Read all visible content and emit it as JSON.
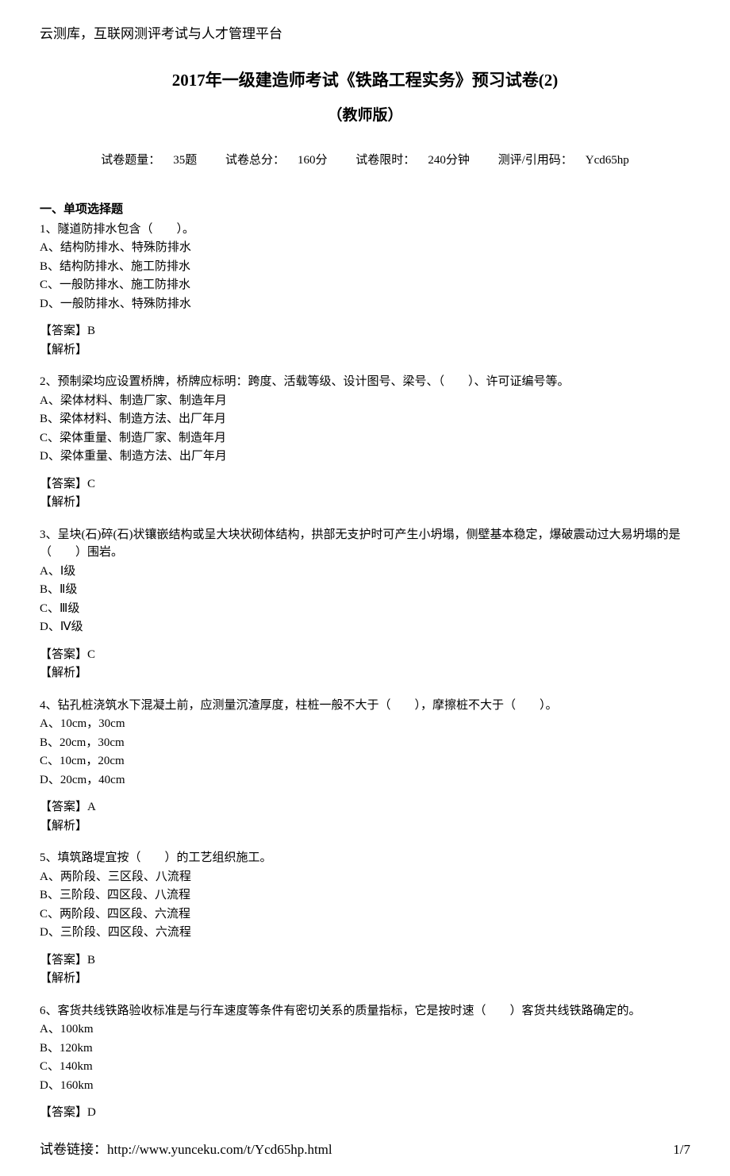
{
  "header": "云测库，互联网测评考试与人才管理平台",
  "title": "2017年一级建造师考试《铁路工程实务》预习试卷(2)",
  "subtitle": "（教师版）",
  "meta": {
    "count_label": "试卷题量：",
    "count_value": "35题",
    "score_label": "试卷总分：",
    "score_value": "160分",
    "time_label": "试卷限时：",
    "time_value": "240分钟",
    "code_label": "测评/引用码：",
    "code_value": "Ycd65hp"
  },
  "section_header": "一、单项选择题",
  "questions": [
    {
      "text": "1、隧道防排水包含（　　）。",
      "options": [
        "A、结构防排水、特殊防排水",
        "B、结构防排水、施工防排水",
        "C、一般防排水、施工防排水",
        "D、一般防排水、特殊防排水"
      ],
      "answer": "【答案】B",
      "analysis": "【解析】"
    },
    {
      "text": "2、预制梁均应设置桥牌，桥牌应标明：跨度、活载等级、设计图号、梁号、（　　）、许可证编号等。",
      "options": [
        "A、梁体材料、制造厂家、制造年月",
        "B、梁体材料、制造方法、出厂年月",
        "C、梁体重量、制造厂家、制造年月",
        "D、梁体重量、制造方法、出厂年月"
      ],
      "answer": "【答案】C",
      "analysis": "【解析】"
    },
    {
      "text": "3、呈块(石)碎(石)状镶嵌结构或呈大块状砌体结构，拱部无支护时可产生小坍塌，侧壁基本稳定，爆破震动过大易坍塌的是（　　）围岩。",
      "options": [
        "A、Ⅰ级",
        "B、Ⅱ级",
        "C、Ⅲ级",
        "D、Ⅳ级"
      ],
      "answer": "【答案】C",
      "analysis": "【解析】"
    },
    {
      "text": "4、钻孔桩浇筑水下混凝土前，应测量沉渣厚度，柱桩一般不大于（　　），摩擦桩不大于（　　）。",
      "options": [
        "A、10cm，30cm",
        "B、20cm，30cm",
        "C、10cm，20cm",
        "D、20cm，40cm"
      ],
      "answer": "【答案】A",
      "analysis": "【解析】"
    },
    {
      "text": "5、填筑路堤宜按（　　）的工艺组织施工。",
      "options": [
        "A、两阶段、三区段、八流程",
        "B、三阶段、四区段、八流程",
        "C、两阶段、四区段、六流程",
        "D、三阶段、四区段、六流程"
      ],
      "answer": "【答案】B",
      "analysis": "【解析】"
    },
    {
      "text": "6、客货共线铁路验收标准是与行车速度等条件有密切关系的质量指标，它是按时速（　　）客货共线铁路确定的。",
      "options": [
        "A、100km",
        "B、120km",
        "C、140km",
        "D、160km"
      ],
      "answer": "【答案】D",
      "analysis": ""
    }
  ],
  "footer": {
    "link_label": "试卷链接：",
    "link_url": "http://www.yunceku.com/t/Ycd65hp.html",
    "page": "1/7"
  }
}
